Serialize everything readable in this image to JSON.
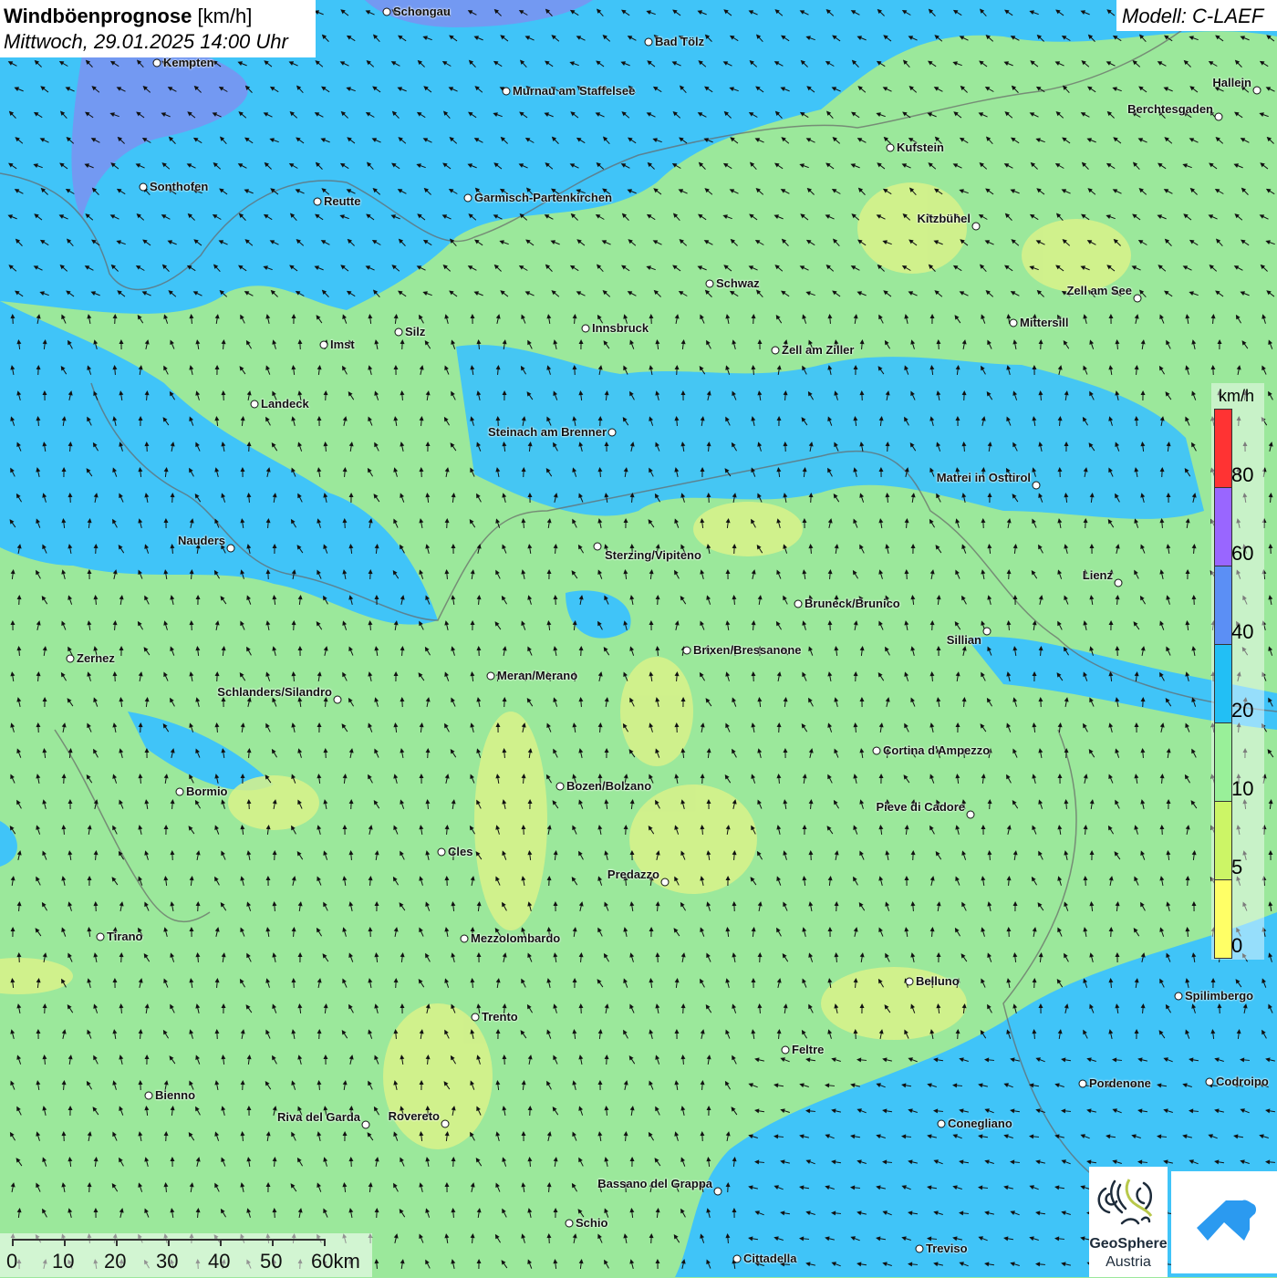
{
  "header": {
    "title": "Windböenprognose",
    "unit": "[km/h]",
    "datetime": "Mittwoch, 29.01.2025 14:00 Uhr",
    "model": "Modell: C-LAEF"
  },
  "legend": {
    "unit": "km/h",
    "ticks": [
      "80",
      "60",
      "40",
      "20",
      "10",
      "5",
      "0"
    ],
    "colors": [
      "#ff3333",
      "#9966ff",
      "#5b8ff5",
      "#22bff5",
      "#99f099",
      "#ccf566",
      "#ffff66"
    ]
  },
  "scalebar": {
    "labels": [
      "0",
      "10",
      "20",
      "30",
      "40",
      "50",
      "60km"
    ]
  },
  "logos": {
    "geosphere_line1": "GeoSphere",
    "geosphere_line2": "Austria"
  },
  "cities": [
    "Schongau",
    "Bad Tölz",
    "Kempten",
    "Murnau am Staffelsee",
    "Hallein",
    "Berchtesgaden",
    "Kufstein",
    "Sonthofen",
    "Reutte",
    "Garmisch-Partenkirchen",
    "Kitzbühel",
    "Schwaz",
    "Zell am See",
    "Mittersill",
    "Innsbruck",
    "Silz",
    "Imst",
    "Zell am Ziller",
    "Landeck",
    "Steinach am Brenner",
    "Matrei in Osttirol",
    "Nauders",
    "Sterzing/Vipiteno",
    "Lienz",
    "Bruneck/Brunico",
    "Sillian",
    "Zernez",
    "Brixen/Bressanone",
    "Meran/Merano",
    "Schlanders/Silandro",
    "Cortina d'Ampezzo",
    "Bozen/Bolzano",
    "Bormio",
    "Pieve di Cadore",
    "Cles",
    "Predazzo",
    "Tirano",
    "Mezzolombardo",
    "Belluno",
    "Spilimbergo",
    "Trento",
    "Feltre",
    "Pordenone",
    "Codroipo",
    "Bienno",
    "Riva del Garda",
    "Rovereto",
    "Conegliano",
    "Bassano del Grappa",
    "Schio",
    "Treviso",
    "Cittadella"
  ],
  "colors": {
    "map_green": "#9be89b",
    "map_blue": "#40c4f8",
    "map_purple": "#7f8ff0",
    "map_yellow": "#d9f28a"
  }
}
